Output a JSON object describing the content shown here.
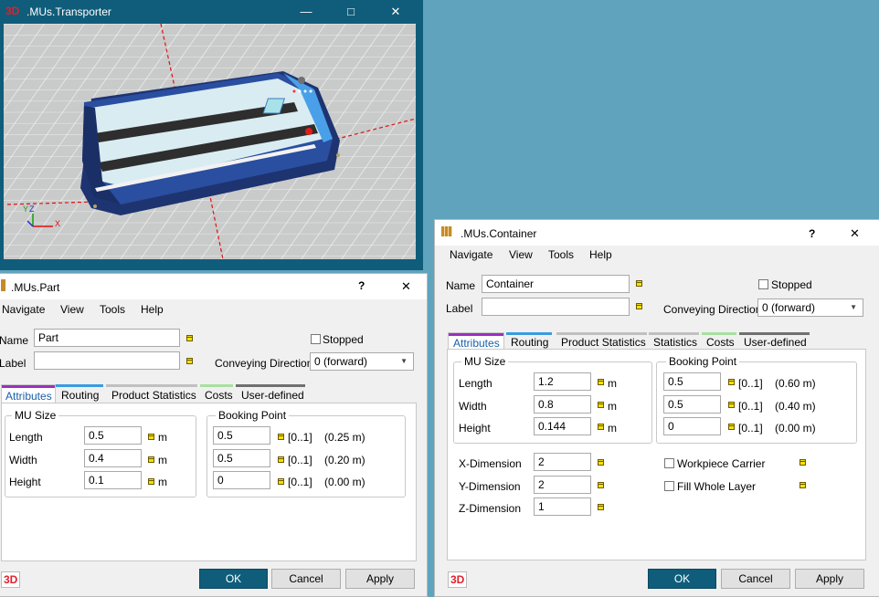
{
  "transporter": {
    "badge": "3D",
    "title": ".MUs.Transporter",
    "axis_y": "Y",
    "axis_z": "Z",
    "axis_x": "X"
  },
  "part": {
    "title": ".MUs.Part",
    "help": "?",
    "menu": [
      "Navigate",
      "View",
      "Tools",
      "Help"
    ],
    "name_label": "Name",
    "name_value": "Part",
    "label_label": "Label",
    "label_value": "",
    "stopped_label": "Stopped",
    "conveying_label": "Conveying Direction",
    "conveying_value": "0 (forward)",
    "tabs": [
      "Attributes",
      "Routing",
      "Product Statistics",
      "Costs",
      "User-defined"
    ],
    "mu_size_label": "MU Size",
    "length_label": "Length",
    "length_value": "0.5",
    "width_label": "Width",
    "width_value": "0.4",
    "height_label": "Height",
    "height_value": "0.1",
    "unit": "m",
    "booking_label": "Booking Point",
    "bp": [
      {
        "value": "0.5",
        "range": "[0..1]",
        "result": "(0.25 m)"
      },
      {
        "value": "0.5",
        "range": "[0..1]",
        "result": "(0.20 m)"
      },
      {
        "value": "0",
        "range": "[0..1]",
        "result": "(0.00 m)"
      }
    ],
    "badge": "3D",
    "ok": "OK",
    "cancel": "Cancel",
    "apply": "Apply"
  },
  "container": {
    "title": ".MUs.Container",
    "help": "?",
    "menu": [
      "Navigate",
      "View",
      "Tools",
      "Help"
    ],
    "name_label": "Name",
    "name_value": "Container",
    "label_label": "Label",
    "label_value": "",
    "stopped_label": "Stopped",
    "conveying_label": "Conveying Direction",
    "conveying_value": "0 (forward)",
    "tabs": [
      "Attributes",
      "Routing",
      "Product Statistics",
      "Statistics",
      "Costs",
      "User-defined"
    ],
    "mu_size_label": "MU Size",
    "length_label": "Length",
    "length_value": "1.2",
    "width_label": "Width",
    "width_value": "0.8",
    "height_label": "Height",
    "height_value": "0.144",
    "unit": "m",
    "booking_label": "Booking Point",
    "bp": [
      {
        "value": "0.5",
        "range": "[0..1]",
        "result": "(0.60 m)"
      },
      {
        "value": "0.5",
        "range": "[0..1]",
        "result": "(0.40 m)"
      },
      {
        "value": "0",
        "range": "[0..1]",
        "result": "(0.00 m)"
      }
    ],
    "xdim_label": "X-Dimension",
    "xdim_value": "2",
    "ydim_label": "Y-Dimension",
    "ydim_value": "2",
    "zdim_label": "Z-Dimension",
    "zdim_value": "1",
    "workpiece_label": "Workpiece Carrier",
    "fill_label": "Fill Whole Layer",
    "badge": "3D",
    "ok": "OK",
    "cancel": "Cancel",
    "apply": "Apply"
  },
  "colors": {
    "accent": "#0f5d7a",
    "desktop": "#5fa3bd",
    "badge_red": "#e0202c",
    "indicator": "#f5e100"
  }
}
